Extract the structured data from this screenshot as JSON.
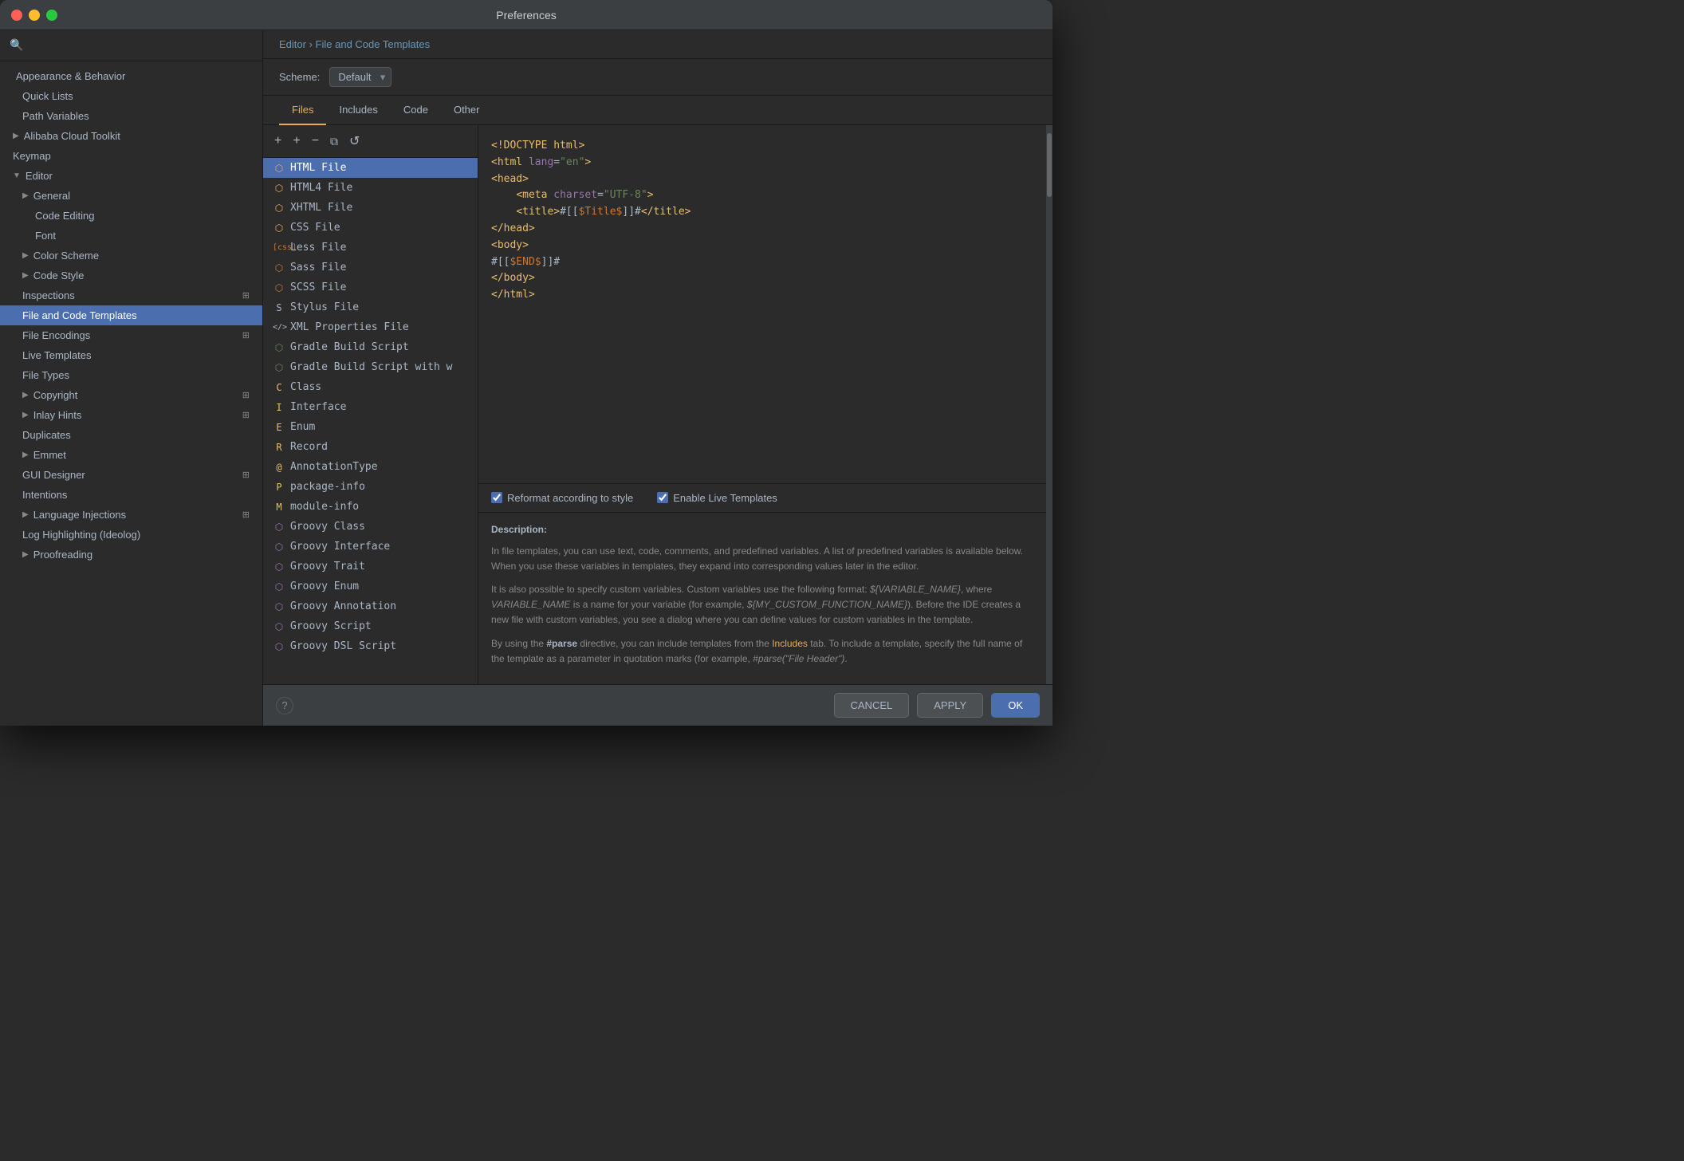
{
  "window": {
    "title": "Preferences"
  },
  "sidebar": {
    "search_placeholder": "🔍",
    "items": [
      {
        "id": "appearance",
        "label": "Appearance & Behavior",
        "indent": 0,
        "arrow": "",
        "has_arrow": false
      },
      {
        "id": "quick-lists",
        "label": "Quick Lists",
        "indent": 1,
        "has_arrow": false
      },
      {
        "id": "path-variables",
        "label": "Path Variables",
        "indent": 1,
        "has_arrow": false
      },
      {
        "id": "alibaba",
        "label": "Alibaba Cloud Toolkit",
        "indent": 0,
        "arrow": "▶",
        "has_arrow": true
      },
      {
        "id": "keymap",
        "label": "Keymap",
        "indent": 0,
        "has_arrow": false
      },
      {
        "id": "editor",
        "label": "Editor",
        "indent": 0,
        "arrow": "▼",
        "has_arrow": true
      },
      {
        "id": "general",
        "label": "General",
        "indent": 1,
        "arrow": "▶",
        "has_arrow": true
      },
      {
        "id": "code-editing",
        "label": "Code Editing",
        "indent": 2,
        "has_arrow": false
      },
      {
        "id": "font",
        "label": "Font",
        "indent": 2,
        "has_arrow": false
      },
      {
        "id": "color-scheme",
        "label": "Color Scheme",
        "indent": 1,
        "arrow": "▶",
        "has_arrow": true
      },
      {
        "id": "code-style",
        "label": "Code Style",
        "indent": 1,
        "arrow": "▶",
        "has_arrow": true
      },
      {
        "id": "inspections",
        "label": "Inspections",
        "indent": 1,
        "has_arrow": false,
        "badge": "⊞"
      },
      {
        "id": "file-code-templates",
        "label": "File and Code Templates",
        "indent": 1,
        "active": true,
        "has_arrow": false
      },
      {
        "id": "file-encodings",
        "label": "File Encodings",
        "indent": 1,
        "has_arrow": false,
        "badge": "⊞"
      },
      {
        "id": "live-templates",
        "label": "Live Templates",
        "indent": 1,
        "has_arrow": false
      },
      {
        "id": "file-types",
        "label": "File Types",
        "indent": 1,
        "has_arrow": false
      },
      {
        "id": "copyright",
        "label": "Copyright",
        "indent": 1,
        "arrow": "▶",
        "has_arrow": true,
        "badge": "⊞"
      },
      {
        "id": "inlay-hints",
        "label": "Inlay Hints",
        "indent": 1,
        "arrow": "▶",
        "has_arrow": true,
        "badge": "⊞"
      },
      {
        "id": "duplicates",
        "label": "Duplicates",
        "indent": 1,
        "has_arrow": false
      },
      {
        "id": "emmet",
        "label": "Emmet",
        "indent": 1,
        "arrow": "▶",
        "has_arrow": true
      },
      {
        "id": "gui-designer",
        "label": "GUI Designer",
        "indent": 1,
        "has_arrow": false,
        "badge": "⊞"
      },
      {
        "id": "intentions",
        "label": "Intentions",
        "indent": 1,
        "has_arrow": false
      },
      {
        "id": "language-injections",
        "label": "Language Injections",
        "indent": 1,
        "arrow": "▶",
        "has_arrow": true,
        "badge": "⊞"
      },
      {
        "id": "log-highlighting",
        "label": "Log Highlighting (Ideolog)",
        "indent": 1,
        "has_arrow": false
      },
      {
        "id": "proofreading",
        "label": "Proofreading",
        "indent": 1,
        "arrow": "▶",
        "has_arrow": true
      }
    ]
  },
  "breadcrumb": {
    "path": "Editor",
    "separator": "›",
    "current": "File and Code Templates"
  },
  "scheme": {
    "label": "Scheme:",
    "value": "Default"
  },
  "tabs": [
    {
      "id": "files",
      "label": "Files",
      "active": true
    },
    {
      "id": "includes",
      "label": "Includes",
      "active": false
    },
    {
      "id": "code",
      "label": "Code",
      "active": false
    },
    {
      "id": "other",
      "label": "Other",
      "active": false
    }
  ],
  "toolbar": {
    "add_label": "+",
    "add2_label": "+",
    "remove_label": "−",
    "copy_label": "⧉",
    "reset_label": "↺"
  },
  "file_list": [
    {
      "id": "html-file",
      "label": "HTML File",
      "icon": "H",
      "color": "#e8aa5a",
      "selected": true
    },
    {
      "id": "html4-file",
      "label": "HTML4 File",
      "icon": "H",
      "color": "#e8aa5a"
    },
    {
      "id": "xhtml-file",
      "label": "XHTML File",
      "icon": "H",
      "color": "#e8aa5a"
    },
    {
      "id": "css-file",
      "label": "CSS File",
      "icon": "C",
      "color": "#e8aa5a"
    },
    {
      "id": "less-file",
      "label": "Less File",
      "icon": "L",
      "color": "#cc7832"
    },
    {
      "id": "sass-file",
      "label": "Sass File",
      "icon": "S",
      "color": "#cc7832"
    },
    {
      "id": "scss-file",
      "label": "SCSS File",
      "icon": "S",
      "color": "#cc7832"
    },
    {
      "id": "stylus-file",
      "label": "Stylus File",
      "icon": "S",
      "color": "#a9b7c6"
    },
    {
      "id": "xml-properties",
      "label": "XML Properties File",
      "icon": "</>",
      "color": "#a9b7c6"
    },
    {
      "id": "gradle-build",
      "label": "Gradle Build Script",
      "icon": "G",
      "color": "#6a8759"
    },
    {
      "id": "gradle-build-w",
      "label": "Gradle Build Script with w",
      "icon": "G",
      "color": "#6a8759"
    },
    {
      "id": "class",
      "label": "Class",
      "icon": "C",
      "color": "#e8bf6a"
    },
    {
      "id": "interface",
      "label": "Interface",
      "icon": "I",
      "color": "#e8bf6a"
    },
    {
      "id": "enum",
      "label": "Enum",
      "icon": "E",
      "color": "#e8bf6a"
    },
    {
      "id": "record",
      "label": "Record",
      "icon": "R",
      "color": "#e8bf6a"
    },
    {
      "id": "annotation-type",
      "label": "AnnotationType",
      "icon": "A",
      "color": "#e8bf6a"
    },
    {
      "id": "package-info",
      "label": "package-info",
      "icon": "P",
      "color": "#e8bf6a"
    },
    {
      "id": "module-info",
      "label": "module-info",
      "icon": "M",
      "color": "#e8bf6a"
    },
    {
      "id": "groovy-class",
      "label": "Groovy Class",
      "icon": "G",
      "color": "#9876aa"
    },
    {
      "id": "groovy-interface",
      "label": "Groovy Interface",
      "icon": "G",
      "color": "#9876aa"
    },
    {
      "id": "groovy-trait",
      "label": "Groovy Trait",
      "icon": "G",
      "color": "#9876aa"
    },
    {
      "id": "groovy-enum",
      "label": "Groovy Enum",
      "icon": "G",
      "color": "#9876aa"
    },
    {
      "id": "groovy-annotation",
      "label": "Groovy Annotation",
      "icon": "G",
      "color": "#9876aa"
    },
    {
      "id": "groovy-script",
      "label": "Groovy Script",
      "icon": "G",
      "color": "#9876aa"
    },
    {
      "id": "groovy-dsl",
      "label": "Groovy DSL Script",
      "icon": "G",
      "color": "#9876aa"
    }
  ],
  "code_template": {
    "lines": [
      {
        "content": "<!DOCTYPE html>"
      },
      {
        "content": "<html lang=\"en\">"
      },
      {
        "content": "<head>"
      },
      {
        "content": "    <meta charset=\"UTF-8\">"
      },
      {
        "content": "    <title>#[[$Title$]]#</title>"
      },
      {
        "content": "</head>"
      },
      {
        "content": "<body>"
      },
      {
        "content": "#[[$END$]]#"
      },
      {
        "content": "</body>"
      },
      {
        "content": "</html>"
      }
    ]
  },
  "options": {
    "reformat": {
      "checked": true,
      "label": "Reformat according to style"
    },
    "live_templates": {
      "checked": true,
      "label": "Enable Live Templates"
    }
  },
  "description": {
    "title": "Description:",
    "paragraphs": [
      "In file templates, you can use text, code, comments, and predefined variables. A list of predefined variables is available below. When you use these variables in templates, they expand into corresponding values later in the editor.",
      "It is also possible to specify custom variables. Custom variables use the following format: ${VARIABLE_NAME}, where VARIABLE_NAME is a name for your variable (for example, ${MY_CUSTOM_FUNCTION_NAME}). Before the IDE creates a new file with custom variables, you see a dialog where you can define values for custom variables in the template.",
      "By using the #parse directive, you can include templates from the Includes tab. To include a template, specify the full name of the template as a parameter in quotation marks (for example, #parse(\"File Header\")."
    ]
  },
  "buttons": {
    "cancel": "CANCEL",
    "apply": "APPLY",
    "ok": "OK",
    "help": "?"
  }
}
